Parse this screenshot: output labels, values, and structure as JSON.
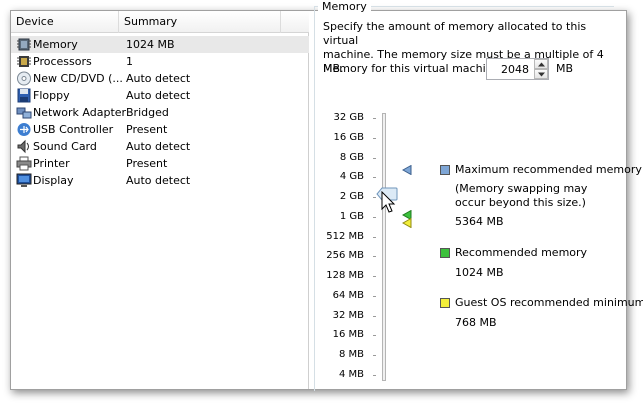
{
  "devices": {
    "header": {
      "device": "Device",
      "summary": "Summary"
    },
    "rows": [
      {
        "name": "Memory",
        "summary": "1024 MB",
        "icon": "memory-chip-icon",
        "selected": true
      },
      {
        "name": "Processors",
        "summary": "1",
        "icon": "processor-icon"
      },
      {
        "name": "New CD/DVD (...",
        "summary": "Auto detect",
        "icon": "cd-dvd-icon"
      },
      {
        "name": "Floppy",
        "summary": "Auto detect",
        "icon": "floppy-icon"
      },
      {
        "name": "Network Adapter",
        "summary": "Bridged",
        "icon": "network-adapter-icon"
      },
      {
        "name": "USB Controller",
        "summary": "Present",
        "icon": "usb-icon"
      },
      {
        "name": "Sound Card",
        "summary": "Auto detect",
        "icon": "sound-card-icon"
      },
      {
        "name": "Printer",
        "summary": "Present",
        "icon": "printer-icon"
      },
      {
        "name": "Display",
        "summary": "Auto detect",
        "icon": "display-icon"
      }
    ]
  },
  "memory": {
    "group_title": "Memory",
    "description_line1": "Specify the amount of memory allocated to this virtual",
    "description_line2": "machine. The memory size must be a multiple of 4 MB.",
    "field_label": "Memory for this virtual machine:",
    "value": "2048",
    "unit": "MB",
    "scale_labels": [
      "32 GB",
      "16 GB",
      "8 GB",
      "4 GB",
      "2 GB",
      "1 GB",
      "512 MB",
      "256 MB",
      "128 MB",
      "64 MB",
      "32 MB",
      "16 MB",
      "8 MB",
      "4 MB"
    ],
    "legend": {
      "max": {
        "title": "Maximum recommended memory",
        "note_line1": "(Memory swapping may",
        "note_line2": "occur beyond this size.)",
        "value": "5364 MB",
        "color": "#7ea6d6"
      },
      "recommended": {
        "title": "Recommended memory",
        "value": "1024 MB",
        "color": "#3cc03c"
      },
      "guest_min": {
        "title": "Guest OS recommended minimum",
        "value": "768 MB",
        "color": "#f2ee3a"
      }
    }
  }
}
